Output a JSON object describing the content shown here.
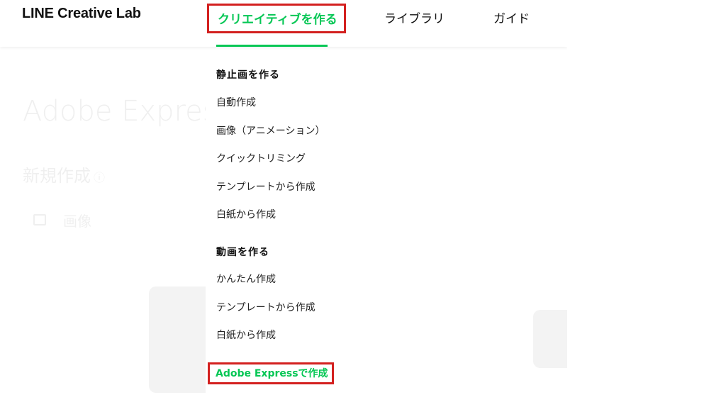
{
  "header": {
    "logo": "LINE Creative Lab",
    "nav": {
      "create": "クリエイティブを作る",
      "library": "ライブラリ",
      "guide": "ガイド"
    }
  },
  "background": {
    "title": "Adobe Expressで作成",
    "new_creation": "新規作成",
    "info_glyph": "ⓘ",
    "image_label": "画像"
  },
  "dropdown": {
    "still": {
      "heading": "静止画を作る",
      "items": [
        "自動作成",
        "画像（アニメーション）",
        "クイックトリミング",
        "テンプレートから作成",
        "白紙から作成"
      ]
    },
    "video": {
      "heading": "動画を作る",
      "items": [
        "かんたん作成",
        "テンプレートから作成",
        "白紙から作成"
      ]
    },
    "adobe_express": "Adobe Expressで作成"
  },
  "colors": {
    "accent": "#06c755",
    "highlight_border": "#d3201f"
  }
}
